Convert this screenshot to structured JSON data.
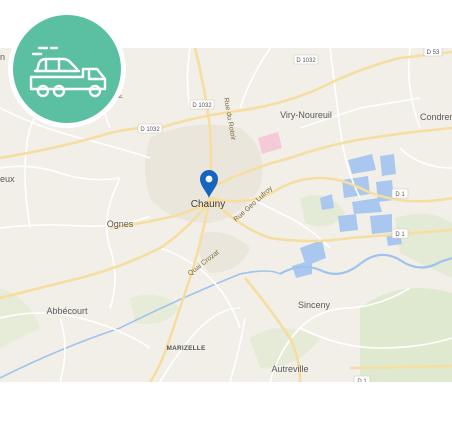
{
  "map": {
    "places": {
      "chauny": "Chauny",
      "viry_noureuil": "Viry-Noureuil",
      "condren": "Condren",
      "ognes": "Ognes",
      "abbecourt": "Abbécourt",
      "sinceny": "Sinceny",
      "marizelle": "MARIZELLE",
      "autreville": "Autreville",
      "partial_left_n": "n",
      "partial_left_eux": "eux"
    },
    "roads": {
      "rue_du_rotoir": "Rue du Rotoir",
      "rue_geo_lufroy": "Rue Geo Lufroy",
      "quai_crozat": "Quai Crozat",
      "d1032_a": "D 1032",
      "d1032_b": "D 1032",
      "d1032_c": "D 1032",
      "d53": "D 53",
      "d1_a": "D 1",
      "d1_b": "D 1",
      "d1_c": "D 1",
      "partial_y": "y"
    },
    "colors": {
      "land": "#f2efe9",
      "major_road": "#f6dea0",
      "minor_road": "#ffffff",
      "water": "#aac8ef",
      "river": "#9fc3ec",
      "park": "#dfe9cf",
      "marker": "#1565c0"
    }
  },
  "badge": {
    "icon": "tow-truck-icon",
    "background": "#5bbfa2"
  }
}
